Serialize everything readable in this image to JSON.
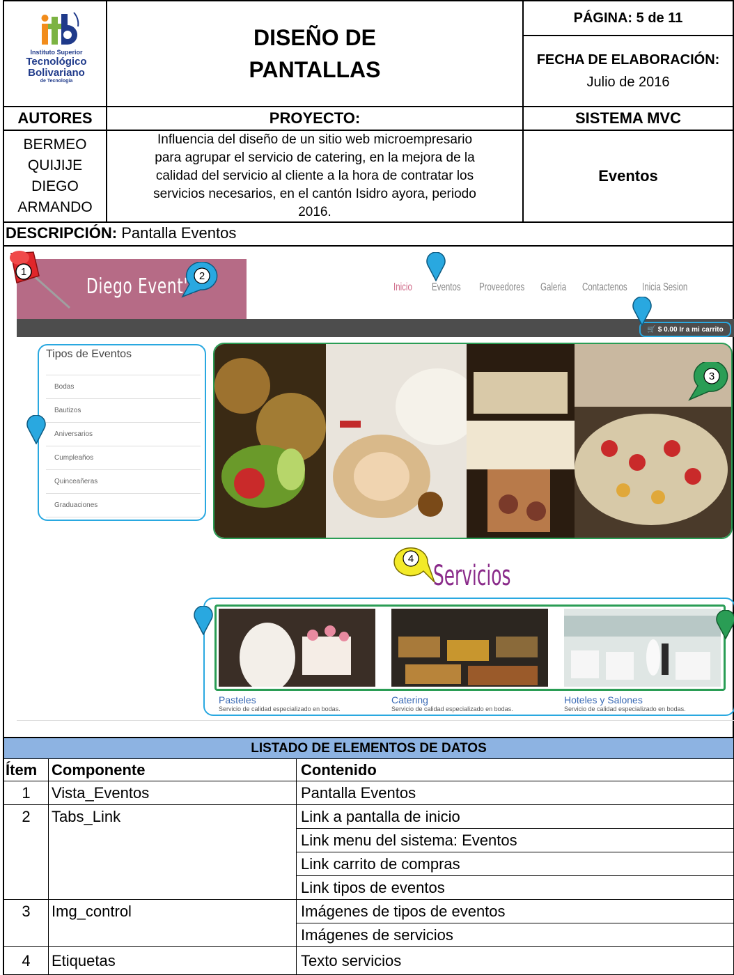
{
  "header": {
    "logo_text": "itb",
    "logo_line1": "Instituto Superior",
    "logo_line2": "Tecnológico",
    "logo_line3": "Bolivariano",
    "logo_line4": "de Tecnología",
    "title_line1": "DISEÑO DE",
    "title_line2": "PANTALLAS",
    "page": "PÁGINA: 5 de 11",
    "date_label": "FECHA DE ELABORACIÓN:",
    "date_value": "Julio de 2016"
  },
  "labels": {
    "authors": "AUTORES",
    "project": "PROYECTO:",
    "system": "SISTEMA MVC"
  },
  "authors": [
    "BERMEO",
    "QUIJIJE",
    "DIEGO",
    "ARMANDO"
  ],
  "project_description": [
    "Influencia del diseño de un sitio web microempresario",
    "para agrupar el servicio de catering, en la mejora de la",
    "calidad del servicio al cliente a la hora de contratar los",
    "servicios necesarios, en el cantón Isidro ayora, periodo",
    "2016."
  ],
  "system_value": "Eventos",
  "description": {
    "label": "DESCRIPCIÓN:",
    "value": " Pantalla Eventos"
  },
  "mockup": {
    "brand": "Diego Event's",
    "nav": [
      "Inicio",
      "Eventos",
      "Proveedores",
      "Galeria",
      "Contactenos",
      "Inicia Sesion"
    ],
    "cart": "$ 0.00 Ir a mi carrito",
    "types_title": "Tipos de Eventos",
    "types": [
      "Bodas",
      "Bautizos",
      "Aniversarios",
      "Cumpleaños",
      "Quinceañeras",
      "Graduaciones"
    ],
    "services_title": "Servicios",
    "services": [
      {
        "name": "Pasteles",
        "desc": "Servicio de calidad especializado en bodas."
      },
      {
        "name": "Catering",
        "desc": "Servicio de calidad especializado en bodas."
      },
      {
        "name": "Hoteles y Salones",
        "desc": "Servicio de calidad especializado en bodas."
      }
    ],
    "badges": [
      "1",
      "2",
      "3",
      "4"
    ]
  },
  "table": {
    "title": "LISTADO DE ELEMENTOS DE DATOS",
    "headers": [
      "Ítem",
      "Componente",
      "Contenido"
    ],
    "rows": [
      {
        "item": "1",
        "component": "Vista_Eventos",
        "content": "Pantalla Eventos"
      },
      {
        "item": "2",
        "component": "Tabs_Link",
        "content": "Link a pantalla de inicio"
      },
      {
        "item": "",
        "component": "",
        "content": "Link menu del sistema: Eventos"
      },
      {
        "item": "",
        "component": "",
        "content": "Link carrito de compras"
      },
      {
        "item": "",
        "component": "",
        "content": "Link tipos de eventos"
      },
      {
        "item": "3",
        "component": "Img_control",
        "content": "Imágenes de tipos de eventos"
      },
      {
        "item": "",
        "component": "",
        "content": "Imágenes de servicios"
      },
      {
        "item": "4",
        "component": "Etiquetas",
        "content": "Texto servicios"
      }
    ]
  },
  "colors": {
    "header_pink": "#b66b86",
    "nav_bar": "#4d4d4d",
    "table_header": "#8db3e2",
    "pin_blue": "#29a8e0",
    "pin_green": "#2a9d55",
    "services_title": "#8a2b8a"
  }
}
